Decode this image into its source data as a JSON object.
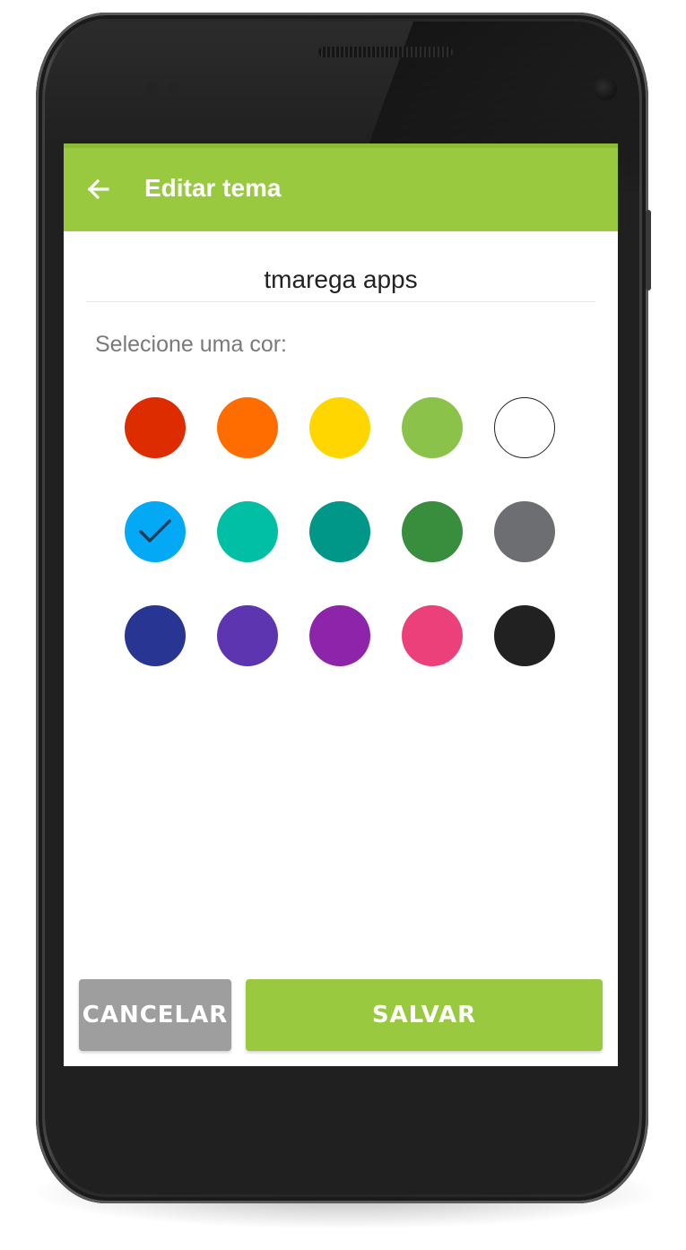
{
  "app_bar": {
    "title": "Editar tema",
    "back_icon": "arrow-left-icon",
    "color": "#99c93f"
  },
  "theme_name": {
    "value": "tmarega apps"
  },
  "color_picker": {
    "prompt": "Selecione uma cor:",
    "selected_index": 5,
    "colors": [
      {
        "name": "red",
        "hex": "#dd2c00"
      },
      {
        "name": "orange",
        "hex": "#ff6d00"
      },
      {
        "name": "yellow",
        "hex": "#ffd600"
      },
      {
        "name": "light-green",
        "hex": "#8bc34a"
      },
      {
        "name": "white",
        "hex": "#ffffff"
      },
      {
        "name": "light-blue",
        "hex": "#03a9f4"
      },
      {
        "name": "turquoise",
        "hex": "#00bfa5"
      },
      {
        "name": "teal",
        "hex": "#009688"
      },
      {
        "name": "green",
        "hex": "#388e3c"
      },
      {
        "name": "gray",
        "hex": "#6d6e71"
      },
      {
        "name": "indigo",
        "hex": "#283593"
      },
      {
        "name": "deep-purple",
        "hex": "#5e35b1"
      },
      {
        "name": "purple",
        "hex": "#8e24aa"
      },
      {
        "name": "pink",
        "hex": "#ec407a"
      },
      {
        "name": "black",
        "hex": "#212121"
      }
    ]
  },
  "actions": {
    "cancel_label": "CANCELAR",
    "save_label": "SALVAR",
    "cancel_color": "#9e9e9e",
    "save_color": "#99c93f"
  }
}
